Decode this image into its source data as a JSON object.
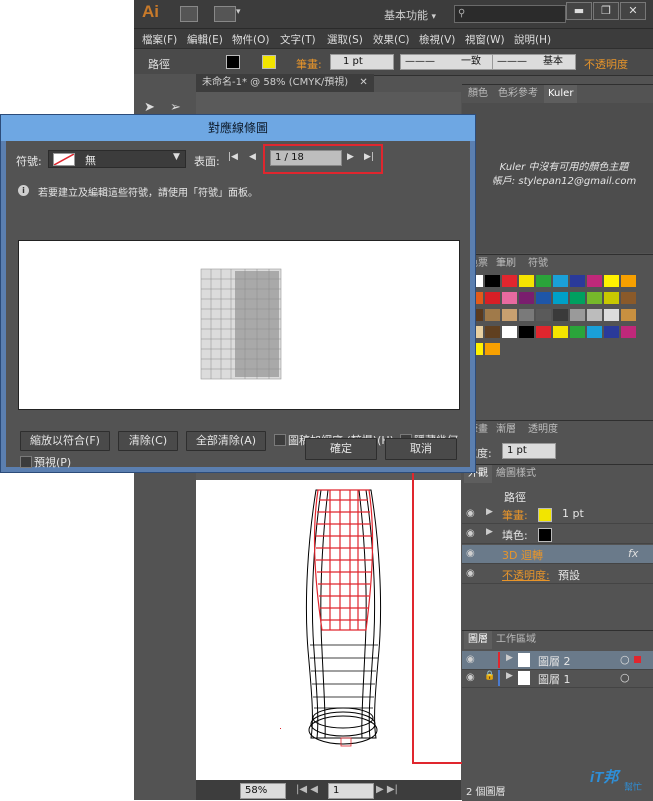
{
  "app": {
    "logo": "Ai",
    "workspace": "基本功能",
    "workspace_caret": "▾",
    "win_minimize": "▬",
    "win_restore": "❐",
    "win_close": "✕"
  },
  "menu": [
    "檔案(F)",
    "編輯(E)",
    "物件(O)",
    "文字(T)",
    "選取(S)",
    "效果(C)",
    "檢視(V)",
    "視窗(W)",
    "說明(H)"
  ],
  "control_bar": {
    "object_label": "路徑",
    "stroke_label": "筆畫:",
    "stroke_weight": "1 pt",
    "profile": "一致",
    "brush": "基本",
    "opacity_label": "不透明度"
  },
  "document_tab": "未命名-1* @ 58% (CMYK/預視)",
  "doc_tab_close": "✕",
  "color_panel": {
    "tabs": [
      "顏色",
      "色彩參考",
      "Kuler"
    ],
    "message": "Kuler 中沒有可用的顏色主題",
    "account": "帳戶: stylepan12@gmail.com"
  },
  "swatch_panel": {
    "tabs": [
      "色票",
      "筆刷",
      "符號"
    ]
  },
  "stroke_panel": {
    "tabs": [
      "筆畫",
      "漸層",
      "透明度"
    ],
    "weight_label": "寬度:",
    "weight_value": "1 pt"
  },
  "appearance_panel": {
    "tabs": [
      "外觀",
      "繪圖樣式"
    ],
    "title": "路徑",
    "stroke_label": "筆畫:",
    "stroke_value": "1 pt",
    "fill_label": "填色:",
    "effect": "3D 迴轉",
    "fx": "fx",
    "opacity_label": "不透明度:",
    "opacity_value": "預設"
  },
  "layers_panel": {
    "tabs": [
      "圖層",
      "工作區域"
    ],
    "layers": [
      "圖層 2",
      "圖層 1"
    ],
    "footer": "2 個圖層"
  },
  "status_bar": {
    "zoom": "58%",
    "page": "1"
  },
  "dialog": {
    "title": "對應線條圖",
    "symbol_label": "符號:",
    "symbol_value": "無",
    "surface_label": "表面:",
    "surface_value": "1 / 18",
    "info": "若要建立及編輯這些符號，請使用「符號」面板。",
    "info_icon": "i",
    "buttons": {
      "scale_to_fit": "縮放以符合(F)",
      "clear": "清除(C)",
      "clear_all": "全部清除(A)",
      "ok": "確定",
      "cancel": "取消"
    },
    "checkboxes": {
      "shade_artwork": "圖稿加網底 (較慢)(H)",
      "invisible_geometry": "隱藏幾何",
      "preview": "預視(P)"
    }
  },
  "watermark": {
    "brand": "iT邦",
    "sub": "幫忙"
  },
  "colors": {
    "accent_blue": "#6ea7e3",
    "highlight_red": "#e0262e",
    "ui_dark": "#535353"
  }
}
